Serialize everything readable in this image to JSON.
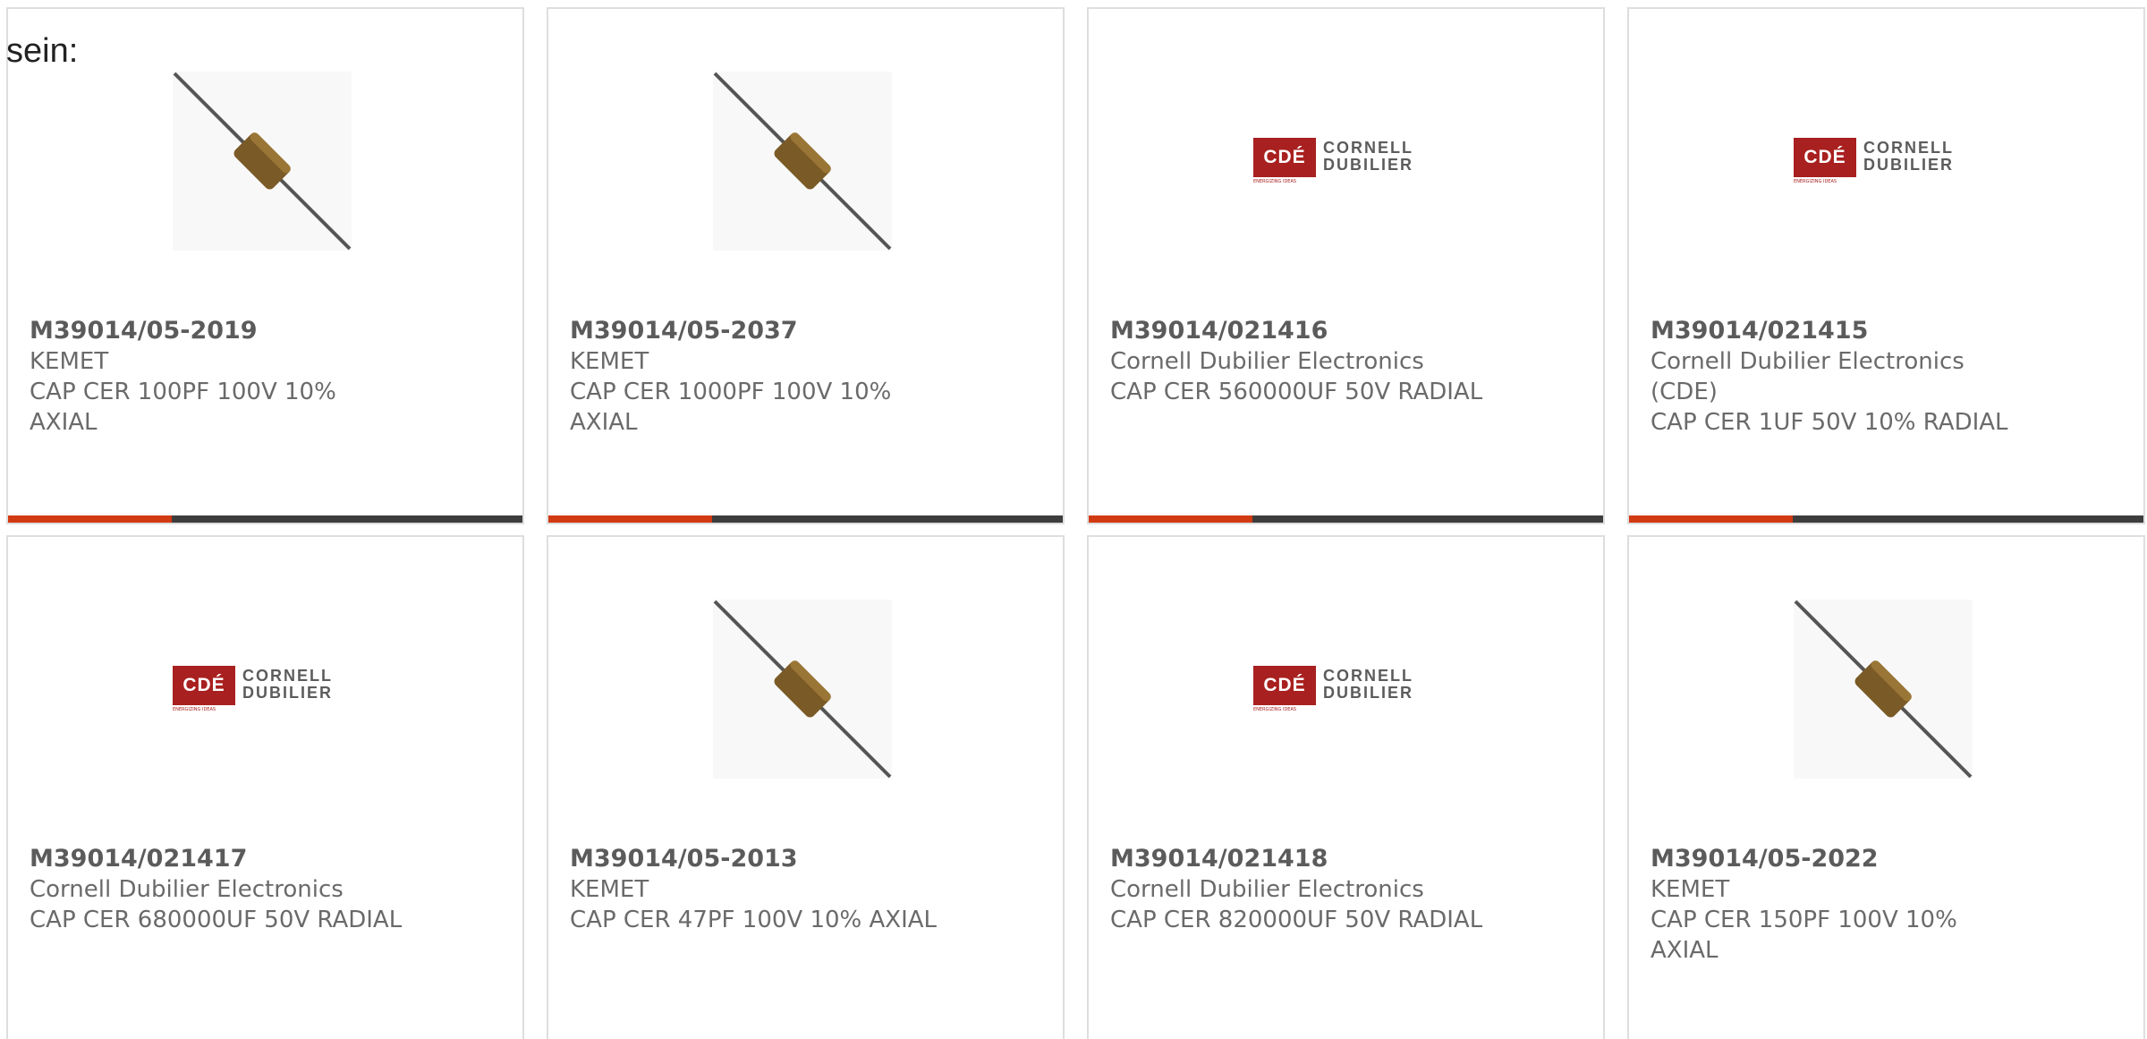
{
  "intro_text": "sein:",
  "colors": {
    "accent": "#d23a12",
    "bar": "#3d3d3d",
    "logo_red": "#a8201f"
  },
  "products": [
    {
      "part_number": "M39014/05-2019",
      "manufacturer": "KEMET",
      "description": "CAP CER 100PF 100V 10% AXIAL",
      "image": "axial-capacitor-image"
    },
    {
      "part_number": "M39014/05-2037",
      "manufacturer": "KEMET",
      "description": "CAP CER 1000PF 100V 10% AXIAL",
      "image": "axial-capacitor-image"
    },
    {
      "part_number": "M39014/021416",
      "manufacturer": "Cornell Dubilier Electronics",
      "description": "CAP CER 560000UF 50V RADIAL",
      "image": "cde-logo"
    },
    {
      "part_number": "M39014/021415",
      "manufacturer": "Cornell Dubilier Electronics (CDE)",
      "description": "CAP CER 1UF 50V 10% RADIAL",
      "image": "cde-logo"
    },
    {
      "part_number": "M39014/021417",
      "manufacturer": "Cornell Dubilier Electronics",
      "description": "CAP CER 680000UF 50V RADIAL",
      "image": "cde-logo"
    },
    {
      "part_number": "M39014/05-2013",
      "manufacturer": "KEMET",
      "description": "CAP CER 47PF 100V 10% AXIAL",
      "image": "axial-capacitor-image"
    },
    {
      "part_number": "M39014/021418",
      "manufacturer": "Cornell Dubilier Electronics",
      "description": "CAP CER 820000UF 50V RADIAL",
      "image": "cde-logo"
    },
    {
      "part_number": "M39014/05-2022",
      "manufacturer": "KEMET",
      "description": "CAP CER 150PF 100V 10% AXIAL",
      "image": "axial-capacitor-image"
    }
  ],
  "cde_logo": {
    "box_text": "CDÉ",
    "tagline": "ENERGIZING IDEAS",
    "line1": "CORNELL",
    "line2": "DUBILIER"
  }
}
